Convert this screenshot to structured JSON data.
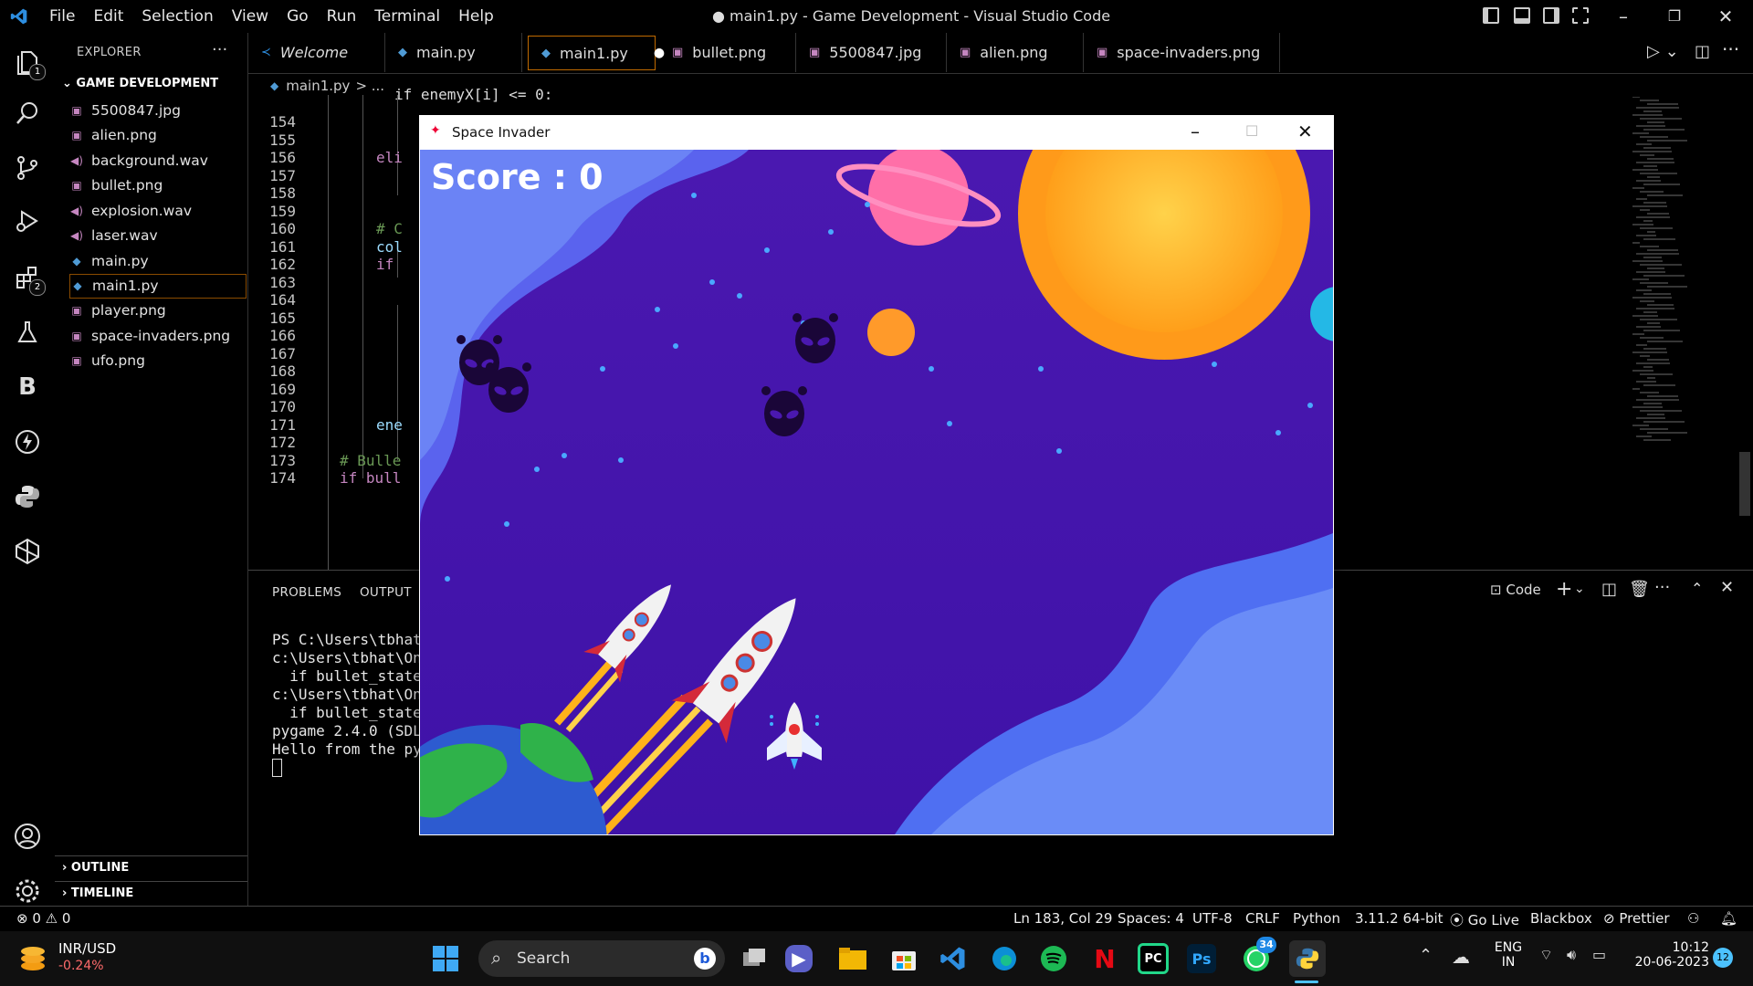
{
  "window": {
    "title": "● main1.py - Game Development - Visual Studio Code",
    "menu": [
      "File",
      "Edit",
      "Selection",
      "View",
      "Go",
      "Run",
      "Terminal",
      "Help"
    ]
  },
  "activity_bar": {
    "items": [
      {
        "name": "explorer-icon",
        "badge": "1"
      },
      {
        "name": "search-icon"
      },
      {
        "name": "source-control-icon"
      },
      {
        "name": "run-debug-icon"
      },
      {
        "name": "extensions-icon",
        "badge": "2"
      },
      {
        "name": "testing-icon"
      },
      {
        "name": "blackbox-icon",
        "glyph": "B"
      },
      {
        "name": "lightning-icon"
      },
      {
        "name": "python-icon"
      },
      {
        "name": "box-icon"
      }
    ],
    "bottom": [
      {
        "name": "account-icon"
      },
      {
        "name": "settings-gear-icon"
      }
    ]
  },
  "explorer": {
    "header": "EXPLORER",
    "project": "GAME DEVELOPMENT",
    "files": [
      {
        "name": "5500847.jpg",
        "type": "image"
      },
      {
        "name": "alien.png",
        "type": "image"
      },
      {
        "name": "background.wav",
        "type": "audio"
      },
      {
        "name": "bullet.png",
        "type": "image"
      },
      {
        "name": "explosion.wav",
        "type": "audio"
      },
      {
        "name": "laser.wav",
        "type": "audio"
      },
      {
        "name": "main.py",
        "type": "python"
      },
      {
        "name": "main1.py",
        "type": "python",
        "selected": true
      },
      {
        "name": "player.png",
        "type": "image"
      },
      {
        "name": "space-invaders.png",
        "type": "image"
      },
      {
        "name": "ufo.png",
        "type": "image"
      }
    ],
    "outline": "OUTLINE",
    "timeline": "TIMELINE"
  },
  "tabs": [
    {
      "label": "Welcome",
      "icon": "vscode-icon",
      "italic": true
    },
    {
      "label": "main.py",
      "icon": "python-icon"
    },
    {
      "label": "main1.py",
      "icon": "python-icon",
      "active": true,
      "dirty": true
    },
    {
      "label": "bullet.png",
      "icon": "image-icon"
    },
    {
      "label": "5500847.jpg",
      "icon": "image-icon"
    },
    {
      "label": "alien.png",
      "icon": "image-icon"
    },
    {
      "label": "space-invaders.png",
      "icon": "image-icon"
    }
  ],
  "breadcrumb": {
    "file": "main1.py",
    "rest": "> ..."
  },
  "editor": {
    "lines": [
      {
        "n": "154",
        "code": ""
      },
      {
        "n": "155",
        "code": ""
      },
      {
        "n": "156",
        "code": "eli"
      },
      {
        "n": "157",
        "code": ""
      },
      {
        "n": "158",
        "code": ""
      },
      {
        "n": "159",
        "code": ""
      },
      {
        "n": "160",
        "code": "# C"
      },
      {
        "n": "161",
        "code": "col"
      },
      {
        "n": "162",
        "code": "if"
      },
      {
        "n": "163",
        "code": ""
      },
      {
        "n": "164",
        "code": ""
      },
      {
        "n": "165",
        "code": ""
      },
      {
        "n": "166",
        "code": ""
      },
      {
        "n": "167",
        "code": ""
      },
      {
        "n": "168",
        "code": ""
      },
      {
        "n": "169",
        "code": ""
      },
      {
        "n": "170",
        "code": ""
      },
      {
        "n": "171",
        "code": "ene"
      },
      {
        "n": "172",
        "code": ""
      },
      {
        "n": "173",
        "code": "# Bulle"
      },
      {
        "n": "174",
        "code": "if bull"
      }
    ],
    "partial_top": "if enemyX[i] <= 0:"
  },
  "panel": {
    "tabs": [
      "PROBLEMS",
      "OUTPUT"
    ],
    "terminal_name": "Code",
    "terminal_lines": [
      "PS C:\\Users\\tbhat\\",
      "c:\\Users\\tbhat\\One",
      "  if bullet_state",
      "c:\\Users\\tbhat\\One",
      "  if bullet_state",
      "pygame 2.4.0 (SDL",
      "Hello from the pyg"
    ]
  },
  "status_bar": {
    "errors": "0",
    "warnings": "0",
    "position": "Ln 183, Col 29",
    "spaces": "Spaces: 4",
    "encoding": "UTF-8",
    "eol": "CRLF",
    "language": "Python",
    "interpreter": "3.11.2 64-bit",
    "go_live": "Go Live",
    "blackbox": "Blackbox",
    "prettier": "Prettier"
  },
  "game": {
    "title": "Space Invader",
    "score": "Score : 0",
    "colors": {
      "bg": "#4a1bb8",
      "wave": "#5b6cf0",
      "sun": "#ffb21a",
      "planet": "#ff6fa8"
    }
  },
  "taskbar": {
    "ticker": {
      "name": "INR/USD",
      "change": "-0.24%"
    },
    "search": "Search",
    "lang_top": "ENG",
    "lang_bottom": "IN",
    "time": "10:12",
    "date": "20-06-2023",
    "notifications": "12",
    "whatsapp_badge": "34",
    "apps": [
      "start",
      "search",
      "task-view",
      "teams",
      "file-explorer",
      "store",
      "vscode",
      "edge",
      "spotify",
      "netflix",
      "pycharm",
      "photoshop",
      "whatsapp",
      "python"
    ]
  }
}
